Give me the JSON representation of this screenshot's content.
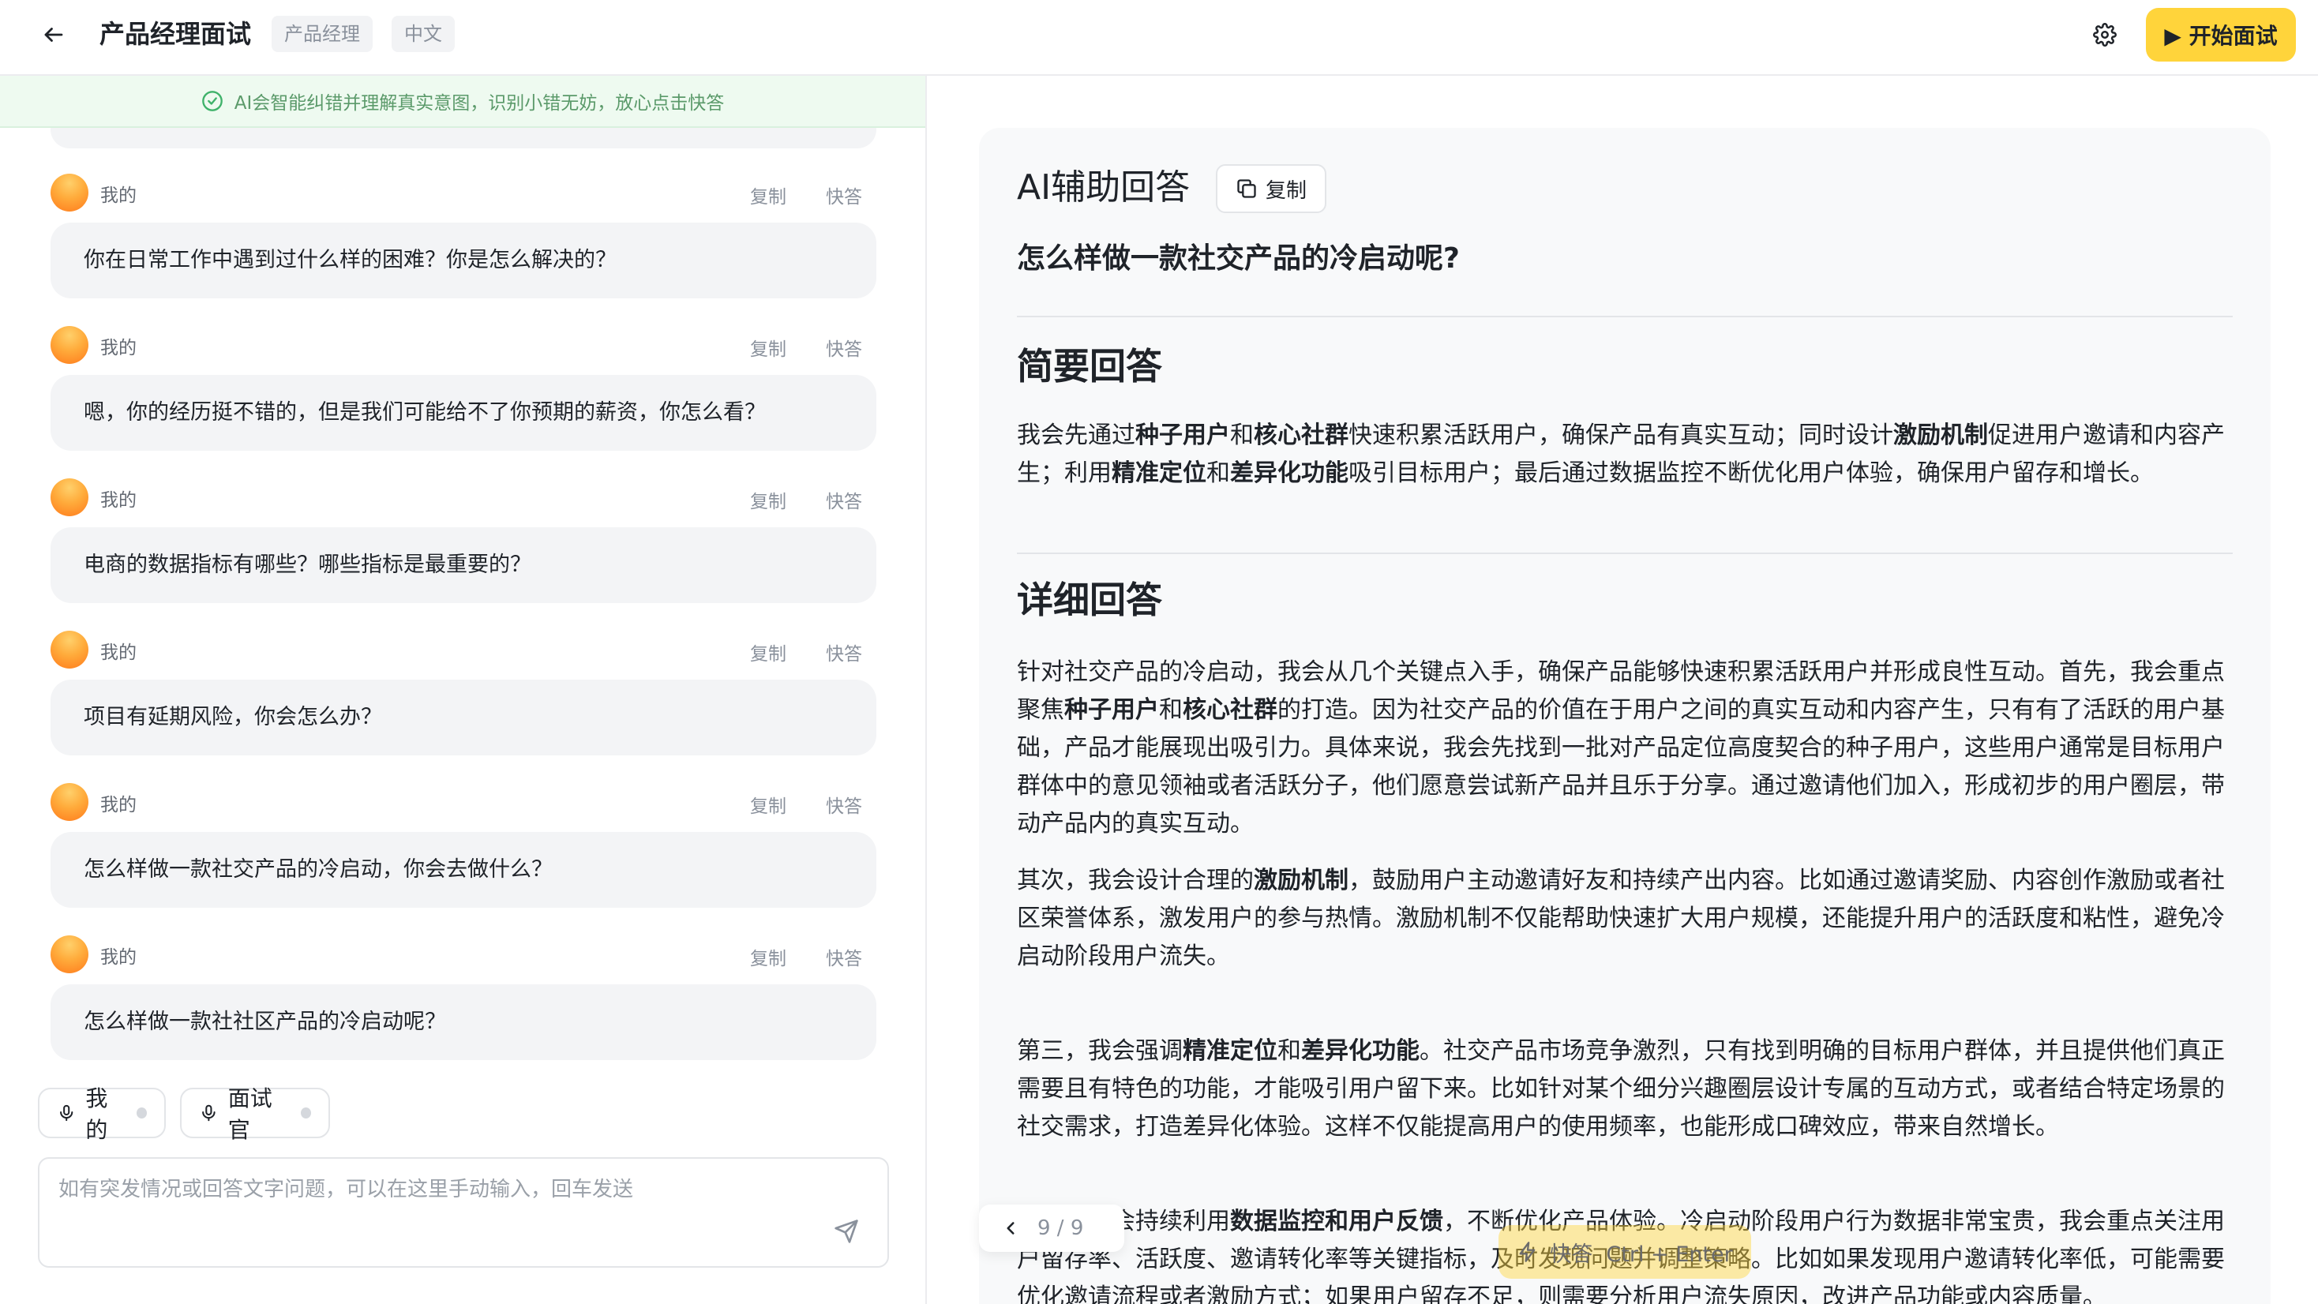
{
  "header": {
    "title": "产品经理面试",
    "tags": [
      "产品经理",
      "中文"
    ],
    "start_button": "▶ 开始面试"
  },
  "left": {
    "notice": "AI会智能纠错并理解真实意图，识别小错无妨，放心点击快答",
    "messages": [
      {
        "speaker": "我的",
        "copy": "复制",
        "quick": "快答",
        "text": "你在日常工作中遇到过什么样的困难？你是怎么解决的？"
      },
      {
        "speaker": "我的",
        "copy": "复制",
        "quick": "快答",
        "text": "嗯，你的经历挺不错的，但是我们可能给不了你预期的薪资，你怎么看？"
      },
      {
        "speaker": "我的",
        "copy": "复制",
        "quick": "快答",
        "text": "电商的数据指标有哪些？哪些指标是最重要的？"
      },
      {
        "speaker": "我的",
        "copy": "复制",
        "quick": "快答",
        "text": "项目有延期风险，你会怎么办？"
      },
      {
        "speaker": "我的",
        "copy": "复制",
        "quick": "快答",
        "text": "怎么样做一款社交产品的冷启动，你会去做什么？"
      },
      {
        "speaker": "我的",
        "copy": "复制",
        "quick": "快答",
        "text": "怎么样做一款社社区产品的冷启动呢？"
      }
    ],
    "speakers": [
      "我的",
      "面试官"
    ],
    "input_placeholder": "如有突发情况或回答文字问题，可以在这里手动输入，回车发送"
  },
  "right": {
    "title": "AI辅助回答",
    "copy_label": "复制",
    "question": "怎么样做一款社交产品的冷启动呢?",
    "brief_heading": "简要回答",
    "brief": [
      {
        "t": "我会先通过"
      },
      {
        "b": "种子用户"
      },
      {
        "t": "和"
      },
      {
        "b": "核心社群"
      },
      {
        "t": "快速积累活跃用户，确保产品有真实互动；同时设计"
      },
      {
        "b": "激励机制"
      },
      {
        "t": "促进用户邀请和内容产生；利用"
      },
      {
        "b": "精准定位"
      },
      {
        "t": "和"
      },
      {
        "b": "差异化功能"
      },
      {
        "t": "吸引目标用户；最后通过数据监控不断优化用户体验，确保用户留存和增长。"
      }
    ],
    "detail_heading": "详细回答",
    "detail": [
      [
        {
          "t": "针对社交产品的冷启动，我会从几个关键点入手，确保产品能够快速积累活跃用户并形成良性互动。首先，我会重点聚焦"
        },
        {
          "b": "种子用户"
        },
        {
          "t": "和"
        },
        {
          "b": "核心社群"
        },
        {
          "t": "的打造。因为社交产品的价值在于用户之间的真实互动和内容产生，只有有了活跃的用户基础，产品才能展现出吸引力。具体来说，我会先找到一批对产品定位高度契合的种子用户，这些用户通常是目标用户群体中的意见领袖或者活跃分子，他们愿意尝试新产品并且乐于分享。通过邀请他们加入，形成初步的用户圈层，带动产品内的真实互动。"
        }
      ],
      [
        {
          "t": "其次，我会设计合理的"
        },
        {
          "b": "激励机制"
        },
        {
          "t": "，鼓励用户主动邀请好友和持续产出内容。比如通过邀请奖励、内容创作激励或者社区荣誉体系，激发用户的参与热情。激励机制不仅能帮助快速扩大用户规模，还能提升用户的活跃度和粘性，避免冷启动阶段用户流失。"
        }
      ],
      [
        {
          "t": "第三，我会强调"
        },
        {
          "b": "精准定位"
        },
        {
          "t": "和"
        },
        {
          "b": "差异化功能"
        },
        {
          "t": "。社交产品市场竞争激烈，只有找到明确的目标用户群体，并且提供他们真正需要且有特色的功能，才能吸引用户留下来。比如针对某个细分兴趣圈层设计专属的互动方式，或者结合特定场景的社交需求，打造差异化体验。这样不仅能提高用户的使用频率，也能形成口碑效应，带来自然增长。"
        }
      ],
      [
        {
          "t": "最后，我会持续利用"
        },
        {
          "b": "数据监控和用户反馈"
        },
        {
          "t": "，不断优化产品体验。冷启动阶段用户行为数据非常宝贵，我会重点关注用户留存率、活跃度、邀请转化率等关键指标，及时发现问题并调整策略。比如如果发现用户邀请转化率低，可能需要优化邀请流程或者激励方式；如果用户留存不足，则需要分析用户流失原因，改进产品功能或内容质量。"
        }
      ]
    ],
    "pager": "9 / 9",
    "quick_answer": "快答  Ctrl + Enter"
  }
}
